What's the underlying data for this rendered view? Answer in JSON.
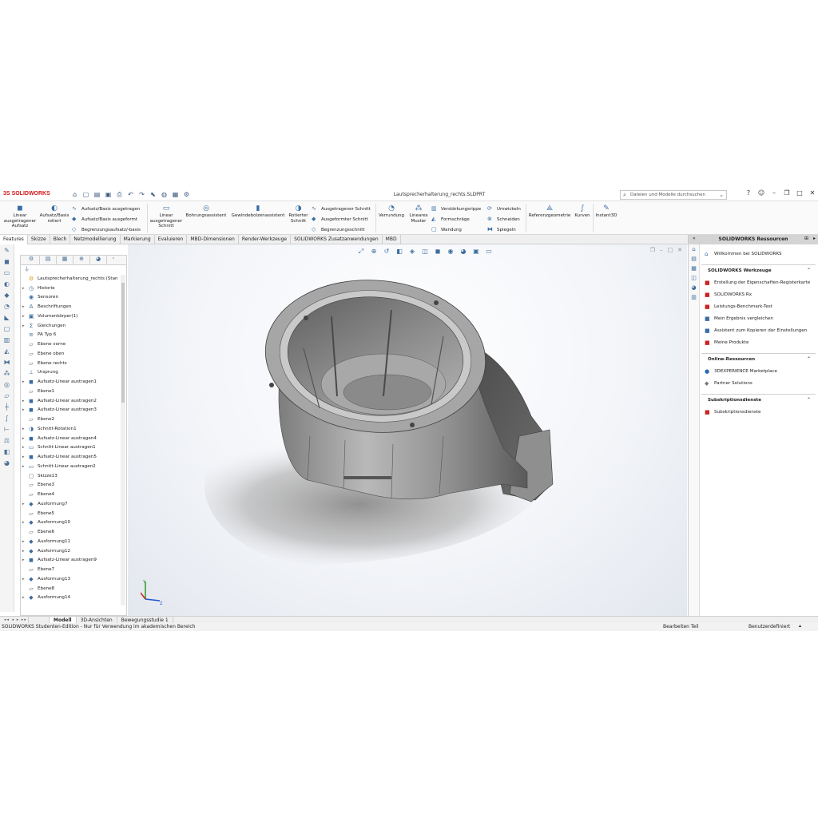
{
  "titlebar": {
    "logo": "SOLIDWORKS",
    "logo_prefix": "3S",
    "document": "Lautsprecherhalterung_rechts.SLDPRT",
    "search_placeholder": "Dateien und Modelle durchsuchen",
    "quick_access_icons": [
      "home-icon",
      "new-icon",
      "open-icon",
      "save-icon",
      "print-icon",
      "undo-icon",
      "redo-icon",
      "select-icon",
      "rebuild-icon",
      "file-props-icon",
      "options-icon"
    ]
  },
  "ribbon": {
    "linear_boss": "Linear ausgetragener Aufsatz",
    "revolved_boss": "Aufsatz/Basis rotiert",
    "swept_boss": "Aufsatz/Basis ausgetragen",
    "lofted_boss": "Aufsatz/Basis ausgeformt",
    "boundary_boss": "Begrenzungsaufsatz/-basis",
    "linear_cut": "Linear ausgetragener Schnitt",
    "hole_wizard": "Bohrungsassistent",
    "thread_wizard": "Gewindebolzenassistent",
    "revolved_cut": "Rotierter Schnitt",
    "swept_cut": "Ausgetragener Schnitt",
    "lofted_cut": "Ausgeformter Schnitt",
    "boundary_cut": "Begrenzungsschnitt",
    "fillet": "Verrundung",
    "linear_pattern": "Lineares Muster",
    "rib": "Verstärkungsrippe",
    "draft": "Formschräge",
    "shell": "Wandung",
    "wrap": "Umwickeln",
    "intersect": "Schneiden",
    "mirror": "Spiegeln",
    "reference_geometry": "Referenzgeometrie",
    "curves": "Kurven",
    "instant3d": "Instant3D"
  },
  "tabs": [
    "Features",
    "Skizze",
    "Blech",
    "Netzmodellierung",
    "Markierung",
    "Evaluieren",
    "MBD-Dimensionen",
    "Render-Werkzeuge",
    "SOLIDWORKS Zusatzanwendungen",
    "MBD"
  ],
  "tree": [
    {
      "label": "Lautsprecherhalterung_rechts (Stan",
      "exp": "",
      "icon": "part-icon"
    },
    {
      "label": "Historie",
      "exp": "▸",
      "icon": "history-icon"
    },
    {
      "label": "Sensoren",
      "exp": "",
      "icon": "sensor-icon"
    },
    {
      "label": "Beschriftungen",
      "exp": "▸",
      "icon": "annotations-icon"
    },
    {
      "label": "Volumenkörper(1)",
      "exp": "▸",
      "icon": "solid-bodies-icon"
    },
    {
      "label": "Gleichungen",
      "exp": "▸",
      "icon": "equations-icon"
    },
    {
      "label": "PA Typ 6",
      "exp": "",
      "icon": "material-icon"
    },
    {
      "label": "Ebene vorne",
      "exp": "",
      "icon": "plane-icon"
    },
    {
      "label": "Ebene oben",
      "exp": "",
      "icon": "plane-icon"
    },
    {
      "label": "Ebene rechts",
      "exp": "",
      "icon": "plane-icon"
    },
    {
      "label": "Ursprung",
      "exp": "",
      "icon": "origin-icon"
    },
    {
      "label": "Aufsatz-Linear austragen1",
      "exp": "▸",
      "icon": "extrude-icon"
    },
    {
      "label": "Ebene1",
      "exp": "",
      "icon": "plane-icon"
    },
    {
      "label": "Aufsatz-Linear austragen2",
      "exp": "▸",
      "icon": "extrude-icon"
    },
    {
      "label": "Aufsatz-Linear austragen3",
      "exp": "▸",
      "icon": "extrude-icon"
    },
    {
      "label": "Ebene2",
      "exp": "",
      "icon": "plane-icon"
    },
    {
      "label": "Schnitt-Rotation1",
      "exp": "▸",
      "icon": "revolve-cut-icon"
    },
    {
      "label": "Aufsatz-Linear austragen4",
      "exp": "▸",
      "icon": "extrude-icon"
    },
    {
      "label": "Schnitt-Linear austragen1",
      "exp": "▸",
      "icon": "cut-extrude-icon"
    },
    {
      "label": "Aufsatz-Linear austragen5",
      "exp": "▸",
      "icon": "extrude-icon"
    },
    {
      "label": "Schnitt-Linear austragen2",
      "exp": "▸",
      "icon": "cut-extrude-icon"
    },
    {
      "label": "Skizze13",
      "exp": "",
      "icon": "sketch-icon"
    },
    {
      "label": "Ebene3",
      "exp": "",
      "icon": "plane-icon"
    },
    {
      "label": "Ebene4",
      "exp": "",
      "icon": "plane-icon"
    },
    {
      "label": "Ausformung7",
      "exp": "▸",
      "icon": "loft-icon"
    },
    {
      "label": "Ebene5",
      "exp": "",
      "icon": "plane-icon"
    },
    {
      "label": "Ausformung10",
      "exp": "▸",
      "icon": "loft-icon"
    },
    {
      "label": "Ebene6",
      "exp": "",
      "icon": "plane-icon"
    },
    {
      "label": "Ausformung11",
      "exp": "▸",
      "icon": "loft-icon"
    },
    {
      "label": "Ausformung12",
      "exp": "▸",
      "icon": "loft-icon"
    },
    {
      "label": "Aufsatz-Linear austragen9",
      "exp": "▸",
      "icon": "extrude-icon"
    },
    {
      "label": "Ebene7",
      "exp": "",
      "icon": "plane-icon"
    },
    {
      "label": "Ausformung13",
      "exp": "▸",
      "icon": "loft-icon"
    },
    {
      "label": "Ebene8",
      "exp": "",
      "icon": "plane-icon"
    },
    {
      "label": "Ausformung14",
      "exp": "▸",
      "icon": "loft-icon"
    }
  ],
  "bottom_tabs": [
    "Modell",
    "3D-Ansichten",
    "Bewegungsstudie 1"
  ],
  "status": {
    "left": "SOLIDWORKS Studenten-Edition - Nur für Verwendung im akademischen Bereich",
    "mode": "Bearbeiten Teil",
    "units": "Benutzerdefiniert"
  },
  "task_pane": {
    "title": "SOLIDWORKS Ressourcen",
    "welcome": "Willkommen bei SOLIDWORKS",
    "tools_header": "SOLIDWORKS Werkzeuge",
    "tools": [
      "Erstellung der Eigenschaften-Registerkarte",
      "SOLIDWORKS Rx",
      "Leistungs-Benchmark-Test",
      "Mein Ergebnis vergleichen",
      "Assistent zum Kopieren der Einstellungen",
      "Meine Produkte"
    ],
    "online_header": "Online-Ressourcen",
    "online": [
      "3DEXPERIENCE Marketplace",
      "Partner Solutions"
    ],
    "subs_header": "Subskriptionsdienste",
    "subs": [
      "Subskriptionsdienste"
    ]
  },
  "colors": {
    "brand": "#d4161b",
    "accent": "#3a6ea5",
    "model_gray": "#8a8a8a"
  }
}
